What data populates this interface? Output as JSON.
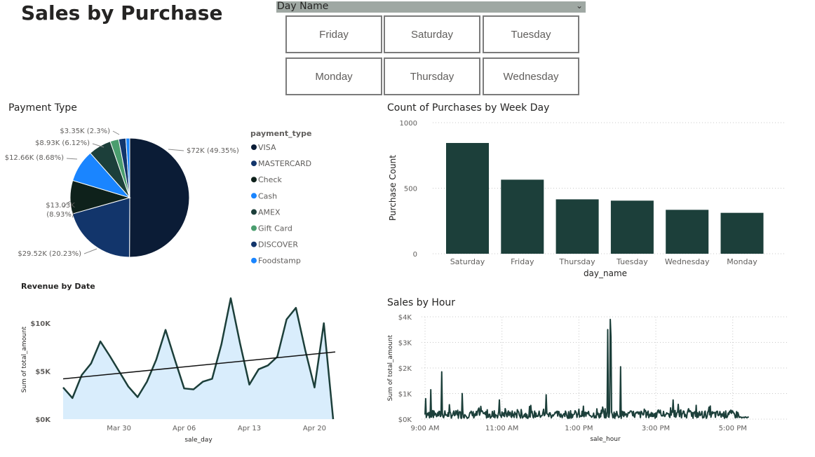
{
  "page": {
    "title": "Sales by Purchase"
  },
  "slicer": {
    "label": "Day Name",
    "options": [
      "Friday",
      "Saturday",
      "Tuesday",
      "Monday",
      "Thursday",
      "Wednesday"
    ]
  },
  "colors": {
    "bar": "#1c3f3a",
    "line": "#1c3f3a",
    "area": "#d9edfc",
    "slicer_header": "#9fa8a3"
  },
  "chart_data": [
    {
      "id": "payment_type",
      "type": "pie",
      "title": "Payment Type",
      "legend_title": "payment_type",
      "legend_position": "right",
      "slices": [
        {
          "name": "VISA",
          "value": 72000,
          "label": "$72K (49.35%)",
          "color": "#0b1c36"
        },
        {
          "name": "MASTERCARD",
          "value": 29520,
          "label": "$29.52K (20.23%)",
          "color": "#12356b"
        },
        {
          "name": "Check",
          "value": 13030,
          "label": "$13.03K (8.93%)",
          "color": "#0e211b"
        },
        {
          "name": "Cash",
          "value": 12660,
          "label": "$12.66K (8.68%)",
          "color": "#1a85ff"
        },
        {
          "name": "AMEX",
          "value": 8930,
          "label": "$8.93K (6.12%)",
          "color": "#1c3f3a"
        },
        {
          "name": "Gift Card",
          "value": 3350,
          "label": "$3.35K (2.3%)",
          "color": "#4a9d6e"
        },
        {
          "name": "DISCOVER",
          "value": 2800,
          "label": "",
          "color": "#12356b"
        },
        {
          "name": "Foodstamp",
          "value": 1500,
          "label": "",
          "color": "#1a85ff"
        }
      ]
    },
    {
      "id": "count_by_weekday",
      "type": "bar",
      "title": "Count of Purchases by Week Day",
      "xlabel": "day_name",
      "ylabel": "Purchase Count",
      "ylim": [
        0,
        1000
      ],
      "yticks": [
        0,
        500,
        1000
      ],
      "categories": [
        "Saturday",
        "Friday",
        "Thursday",
        "Tuesday",
        "Wednesday",
        "Monday"
      ],
      "values": [
        845,
        565,
        415,
        405,
        335,
        312
      ],
      "grid": true
    },
    {
      "id": "revenue_by_date",
      "type": "area",
      "title": "Revenue by Date",
      "xlabel": "sale_day",
      "ylabel": "Sum of total_amount",
      "ylim": [
        0,
        13000
      ],
      "yticks": [
        {
          "v": 0,
          "label": "$0K"
        },
        {
          "v": 5000,
          "label": "$5K"
        },
        {
          "v": 10000,
          "label": "$10K"
        }
      ],
      "xticks": [
        {
          "i": 6,
          "label": "Mar 30"
        },
        {
          "i": 13,
          "label": "Apr 06"
        },
        {
          "i": 20,
          "label": "Apr 13"
        },
        {
          "i": 27,
          "label": "Apr 20"
        }
      ],
      "values": [
        3300,
        2200,
        4600,
        5800,
        8100,
        6600,
        5000,
        3400,
        2300,
        3900,
        6200,
        9300,
        6200,
        3200,
        3100,
        3900,
        4200,
        7800,
        12600,
        7900,
        3600,
        5200,
        5600,
        6500,
        10400,
        11600,
        7200,
        3300,
        10000,
        0
      ],
      "trend": [
        4200,
        7000
      ]
    },
    {
      "id": "sales_by_hour",
      "type": "line",
      "title": "Sales by Hour",
      "xlabel": "sale_hour",
      "ylabel": "Sum of total_amount",
      "ylim": [
        0,
        4000
      ],
      "yticks": [
        {
          "v": 0,
          "label": "$0K"
        },
        {
          "v": 1000,
          "label": "$1K"
        },
        {
          "v": 2000,
          "label": "$2K"
        },
        {
          "v": 3000,
          "label": "$3K"
        },
        {
          "v": 4000,
          "label": "$4K"
        }
      ],
      "xticks": [
        "9:00 AM",
        "11:00 AM",
        "1:00 PM",
        "3:00 PM",
        "5:00 PM"
      ],
      "peaks": [
        {
          "t": 540.5,
          "v": 800
        },
        {
          "t": 549,
          "v": 1150
        },
        {
          "t": 566,
          "v": 1850
        },
        {
          "t": 598,
          "v": 1000
        },
        {
          "t": 627,
          "v": 500
        },
        {
          "t": 656,
          "v": 750
        },
        {
          "t": 729,
          "v": 950
        },
        {
          "t": 825,
          "v": 3500
        },
        {
          "t": 829,
          "v": 3900
        },
        {
          "t": 830,
          "v": 3200
        },
        {
          "t": 845,
          "v": 2050
        },
        {
          "t": 927,
          "v": 750
        }
      ],
      "end_minute": 1045
    }
  ]
}
